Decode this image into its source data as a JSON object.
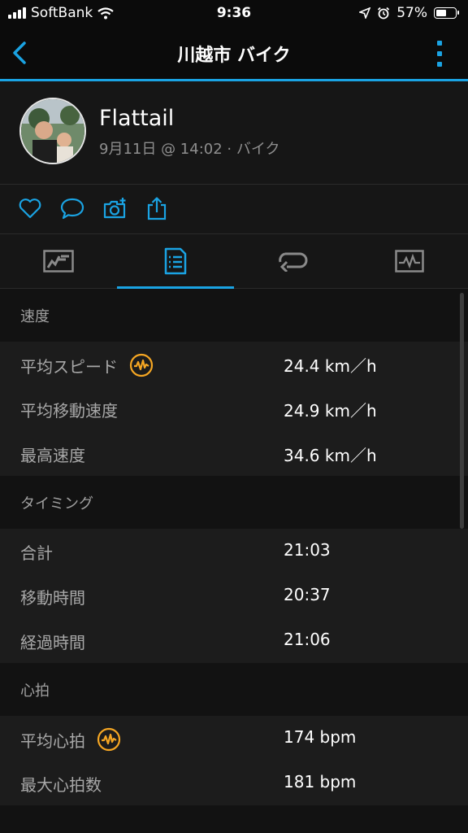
{
  "status_bar": {
    "carrier": "SoftBank",
    "time": "9:36",
    "battery": "57%",
    "battery_level": 0.57
  },
  "nav": {
    "title": "川越市 バイク"
  },
  "profile": {
    "name": "Flattail",
    "meta": "9月11日 @ 14:02 · バイク"
  },
  "sections": {
    "speed": {
      "title": "速度",
      "rows": [
        {
          "label": "平均スピード",
          "value": "24.4 km／h",
          "badge": true
        },
        {
          "label": "平均移動速度",
          "value": "24.9 km／h"
        },
        {
          "label": "最高速度",
          "value": "34.6 km／h"
        }
      ]
    },
    "timing": {
      "title": "タイミング",
      "rows": [
        {
          "label": "合計",
          "value": "21:03"
        },
        {
          "label": "移動時間",
          "value": "20:37"
        },
        {
          "label": "経過時間",
          "value": "21:06"
        }
      ]
    },
    "heart": {
      "title": "心拍",
      "rows": [
        {
          "label": "平均心拍",
          "value": "174 bpm",
          "badge": true
        },
        {
          "label": "最大心拍数",
          "value": "181 bpm"
        }
      ]
    }
  },
  "colors": {
    "accent": "#1aa3e3",
    "badge": "#f5a623",
    "background": "#121212"
  },
  "icons": {
    "actions": [
      "heart-icon",
      "comment-icon",
      "add-photo-icon",
      "share-icon"
    ],
    "tabs": [
      "map-overview-icon",
      "stats-list-icon",
      "laps-icon",
      "charts-icon"
    ]
  }
}
